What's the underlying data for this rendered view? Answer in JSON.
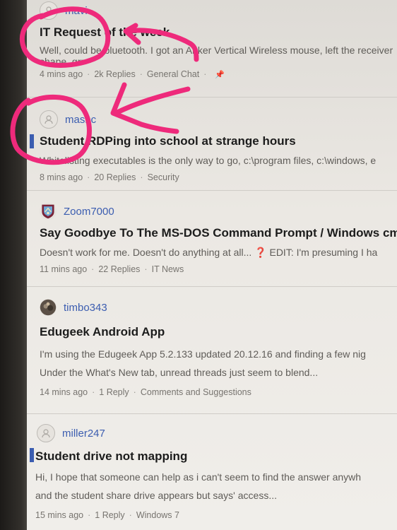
{
  "threads": [
    {
      "author": "mavi",
      "title": "IT Request of the week",
      "snippet": "Well, could be bluetooth. I got an Anker Vertical Wireless mouse, left the receiver",
      "snippet2": "shape, grr",
      "time": "4 mins ago",
      "replies": "2k Replies",
      "forum": "General Chat",
      "pinned": true
    },
    {
      "author": "mashc",
      "title": "Student RDPing into school at strange hours",
      "snippet": "Whitelisting executables is the only way to go, c:\\program files, c:\\windows, e",
      "time": "8 mins ago",
      "replies": "20 Replies",
      "forum": "Security"
    },
    {
      "author": "Zoom7000",
      "title": "Say Goodbye To The MS-DOS Command Prompt / Windows cm",
      "snippet": "Doesn't work for me. Doesn't do anything at all... ❓ EDIT: I'm presuming I ha",
      "time": "11 mins ago",
      "replies": "22 Replies",
      "forum": "IT News"
    },
    {
      "author": "timbo343",
      "title": "Edugeek Android App",
      "snippet": "I'm using the Edugeek App 5.2.133 updated 20.12.16 and finding a few nig",
      "snippet2": "Under the What's New tab, unread threads just seem to blend...",
      "time": "14 mins ago",
      "replies": "1 Reply",
      "forum": "Comments and Suggestions"
    },
    {
      "author": "miller247",
      "title": "Student drive not mapping",
      "snippet": "Hi, I hope that someone can help as i can't seem to find the answer anywh",
      "snippet2": "and the student share drive appears but says' access...",
      "time": "15 mins ago",
      "replies": "1 Reply",
      "forum": "Windows 7"
    }
  ],
  "colors": {
    "accent": "#3b5db0",
    "annotation": "#ee2a7b"
  }
}
